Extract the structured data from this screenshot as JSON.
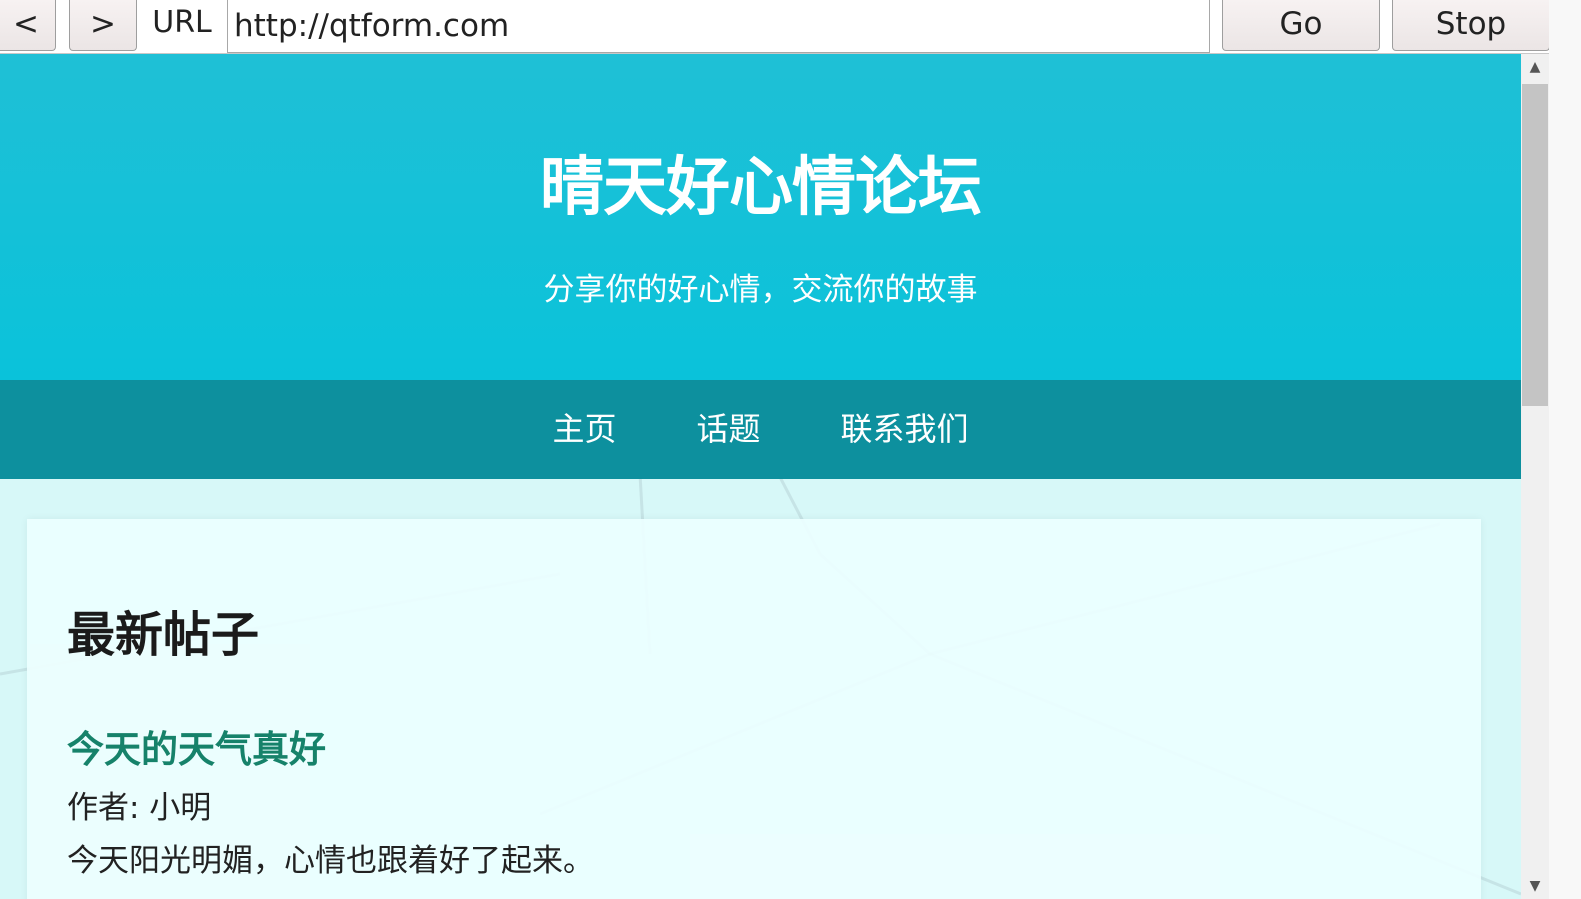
{
  "browser": {
    "back_label": "<",
    "forward_label": ">",
    "url_label": "URL",
    "url_value": "http://qtform.com",
    "go_label": "Go",
    "stop_label": "Stop"
  },
  "header": {
    "title": "晴天好心情论坛",
    "subtitle": "分享你的好心情，交流你的故事"
  },
  "nav": {
    "items": [
      {
        "label": "主页"
      },
      {
        "label": "话题"
      },
      {
        "label": "联系我们"
      }
    ]
  },
  "main": {
    "heading": "最新帖子",
    "posts": [
      {
        "title": "今天的天气真好",
        "author": "作者: 小明",
        "excerpt": "今天阳光明媚，心情也跟着好了起来。"
      }
    ]
  },
  "colors": {
    "header_bg": "#12c0d8",
    "nav_bg": "#0d909e",
    "post_title": "#16826a",
    "page_bg": "#d7f8f8"
  }
}
